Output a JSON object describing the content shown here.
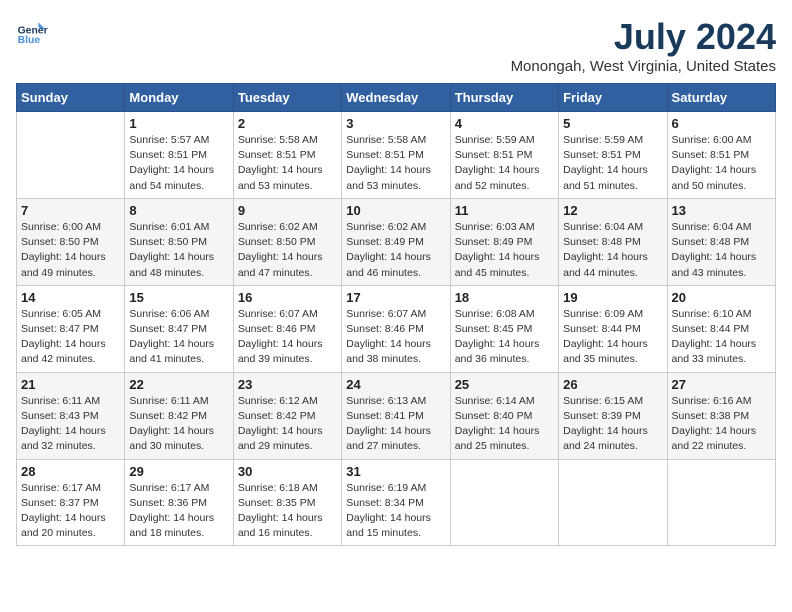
{
  "logo": {
    "line1": "General",
    "line2": "Blue"
  },
  "title": "July 2024",
  "location": "Monongah, West Virginia, United States",
  "weekdays": [
    "Sunday",
    "Monday",
    "Tuesday",
    "Wednesday",
    "Thursday",
    "Friday",
    "Saturday"
  ],
  "weeks": [
    [
      {
        "day": "",
        "info": ""
      },
      {
        "day": "1",
        "info": "Sunrise: 5:57 AM\nSunset: 8:51 PM\nDaylight: 14 hours\nand 54 minutes."
      },
      {
        "day": "2",
        "info": "Sunrise: 5:58 AM\nSunset: 8:51 PM\nDaylight: 14 hours\nand 53 minutes."
      },
      {
        "day": "3",
        "info": "Sunrise: 5:58 AM\nSunset: 8:51 PM\nDaylight: 14 hours\nand 53 minutes."
      },
      {
        "day": "4",
        "info": "Sunrise: 5:59 AM\nSunset: 8:51 PM\nDaylight: 14 hours\nand 52 minutes."
      },
      {
        "day": "5",
        "info": "Sunrise: 5:59 AM\nSunset: 8:51 PM\nDaylight: 14 hours\nand 51 minutes."
      },
      {
        "day": "6",
        "info": "Sunrise: 6:00 AM\nSunset: 8:51 PM\nDaylight: 14 hours\nand 50 minutes."
      }
    ],
    [
      {
        "day": "7",
        "info": "Sunrise: 6:00 AM\nSunset: 8:50 PM\nDaylight: 14 hours\nand 49 minutes."
      },
      {
        "day": "8",
        "info": "Sunrise: 6:01 AM\nSunset: 8:50 PM\nDaylight: 14 hours\nand 48 minutes."
      },
      {
        "day": "9",
        "info": "Sunrise: 6:02 AM\nSunset: 8:50 PM\nDaylight: 14 hours\nand 47 minutes."
      },
      {
        "day": "10",
        "info": "Sunrise: 6:02 AM\nSunset: 8:49 PM\nDaylight: 14 hours\nand 46 minutes."
      },
      {
        "day": "11",
        "info": "Sunrise: 6:03 AM\nSunset: 8:49 PM\nDaylight: 14 hours\nand 45 minutes."
      },
      {
        "day": "12",
        "info": "Sunrise: 6:04 AM\nSunset: 8:48 PM\nDaylight: 14 hours\nand 44 minutes."
      },
      {
        "day": "13",
        "info": "Sunrise: 6:04 AM\nSunset: 8:48 PM\nDaylight: 14 hours\nand 43 minutes."
      }
    ],
    [
      {
        "day": "14",
        "info": "Sunrise: 6:05 AM\nSunset: 8:47 PM\nDaylight: 14 hours\nand 42 minutes."
      },
      {
        "day": "15",
        "info": "Sunrise: 6:06 AM\nSunset: 8:47 PM\nDaylight: 14 hours\nand 41 minutes."
      },
      {
        "day": "16",
        "info": "Sunrise: 6:07 AM\nSunset: 8:46 PM\nDaylight: 14 hours\nand 39 minutes."
      },
      {
        "day": "17",
        "info": "Sunrise: 6:07 AM\nSunset: 8:46 PM\nDaylight: 14 hours\nand 38 minutes."
      },
      {
        "day": "18",
        "info": "Sunrise: 6:08 AM\nSunset: 8:45 PM\nDaylight: 14 hours\nand 36 minutes."
      },
      {
        "day": "19",
        "info": "Sunrise: 6:09 AM\nSunset: 8:44 PM\nDaylight: 14 hours\nand 35 minutes."
      },
      {
        "day": "20",
        "info": "Sunrise: 6:10 AM\nSunset: 8:44 PM\nDaylight: 14 hours\nand 33 minutes."
      }
    ],
    [
      {
        "day": "21",
        "info": "Sunrise: 6:11 AM\nSunset: 8:43 PM\nDaylight: 14 hours\nand 32 minutes."
      },
      {
        "day": "22",
        "info": "Sunrise: 6:11 AM\nSunset: 8:42 PM\nDaylight: 14 hours\nand 30 minutes."
      },
      {
        "day": "23",
        "info": "Sunrise: 6:12 AM\nSunset: 8:42 PM\nDaylight: 14 hours\nand 29 minutes."
      },
      {
        "day": "24",
        "info": "Sunrise: 6:13 AM\nSunset: 8:41 PM\nDaylight: 14 hours\nand 27 minutes."
      },
      {
        "day": "25",
        "info": "Sunrise: 6:14 AM\nSunset: 8:40 PM\nDaylight: 14 hours\nand 25 minutes."
      },
      {
        "day": "26",
        "info": "Sunrise: 6:15 AM\nSunset: 8:39 PM\nDaylight: 14 hours\nand 24 minutes."
      },
      {
        "day": "27",
        "info": "Sunrise: 6:16 AM\nSunset: 8:38 PM\nDaylight: 14 hours\nand 22 minutes."
      }
    ],
    [
      {
        "day": "28",
        "info": "Sunrise: 6:17 AM\nSunset: 8:37 PM\nDaylight: 14 hours\nand 20 minutes."
      },
      {
        "day": "29",
        "info": "Sunrise: 6:17 AM\nSunset: 8:36 PM\nDaylight: 14 hours\nand 18 minutes."
      },
      {
        "day": "30",
        "info": "Sunrise: 6:18 AM\nSunset: 8:35 PM\nDaylight: 14 hours\nand 16 minutes."
      },
      {
        "day": "31",
        "info": "Sunrise: 6:19 AM\nSunset: 8:34 PM\nDaylight: 14 hours\nand 15 minutes."
      },
      {
        "day": "",
        "info": ""
      },
      {
        "day": "",
        "info": ""
      },
      {
        "day": "",
        "info": ""
      }
    ]
  ]
}
